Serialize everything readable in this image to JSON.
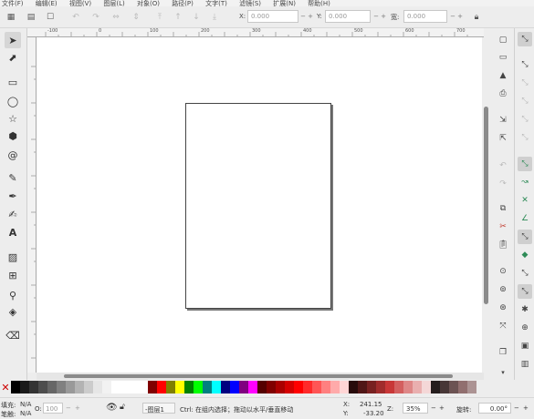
{
  "menu": [
    "文件(F)",
    "编辑(E)",
    "视图(V)",
    "图层(L)",
    "对象(O)",
    "路径(P)",
    "文字(T)",
    "滤镜(S)",
    "扩展(N)",
    "帮助(H)"
  ],
  "controls": {
    "x_label": "X:",
    "x_value": "0.000",
    "y_label": "Y:",
    "y_value": "0.000",
    "w_label": "宽:",
    "w_value": "0.000"
  },
  "ruler": {
    "h_ticks": [
      "-100",
      "0",
      "100",
      "200",
      "300",
      "400",
      "500",
      "600",
      "700",
      "800"
    ],
    "v_ticks": [
      "-200",
      "-100",
      "0",
      "100",
      "200",
      "300",
      "400",
      "500",
      "600",
      "700"
    ]
  },
  "palette": {
    "none_icon": "x-icon",
    "colors": [
      "#000000",
      "#1a1a1a",
      "#333333",
      "#4d4d4d",
      "#666666",
      "#808080",
      "#999999",
      "#b3b3b3",
      "#cccccc",
      "#e6e6e6",
      "#f2f2f2",
      "#ffffff",
      "#ffffff",
      "#ffffff",
      "#ffffff",
      "#800000",
      "#ff0000",
      "#808000",
      "#ffff00",
      "#008000",
      "#00ff00",
      "#008080",
      "#00ffff",
      "#000080",
      "#0000ff",
      "#800080",
      "#ff00ff",
      "#550000",
      "#800000",
      "#aa0000",
      "#d40000",
      "#ff0000",
      "#ff2a2a",
      "#ff5555",
      "#ff8080",
      "#ffaaaa",
      "#ffd5d5",
      "#280b0b",
      "#501616",
      "#782121",
      "#a02c2c",
      "#c83737",
      "#d35f5f",
      "#de8787",
      "#e9afaf",
      "#f4d7d7",
      "#241c1c",
      "#483737",
      "#6c5353",
      "#916f6f",
      "#ac9393"
    ]
  },
  "status": {
    "fill_label": "填充:",
    "fill_value": "N/A",
    "stroke_label": "笔触:",
    "stroke_value": "N/A",
    "opacity_label": "O:",
    "opacity_value": "100",
    "layer_value": "-图层1",
    "message": "Ctrl: 在组内选择；拖动以水平/垂直移动",
    "x_label": "X:",
    "x_value": "241.15",
    "y_label": "Y:",
    "y_value": "-33.20",
    "z_label": "Z:",
    "zoom_value": "35%",
    "rotate_label": "旋转:",
    "rotate_value": "0.00°"
  }
}
